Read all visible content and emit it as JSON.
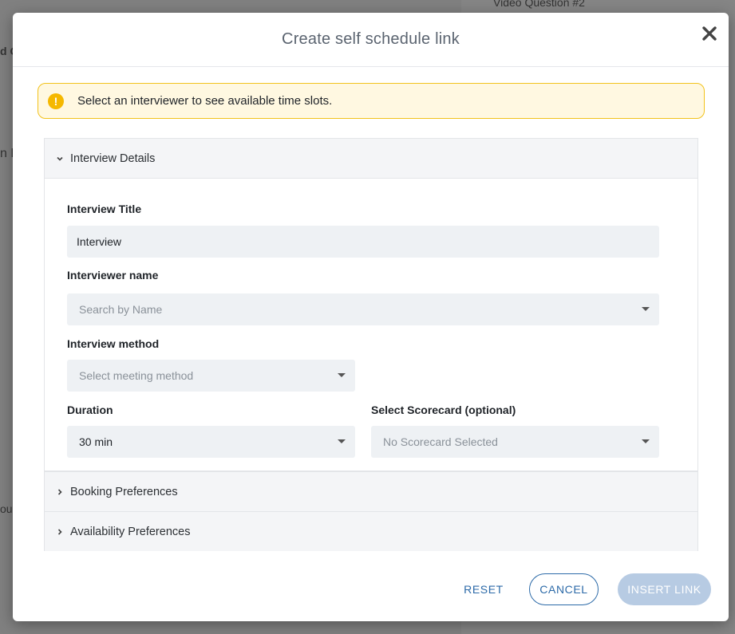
{
  "background": {
    "text_top": "Video Question #2",
    "text_left_1": "d G",
    "text_left_2": "n F",
    "text_left_3": "ou"
  },
  "modal": {
    "title": "Create self schedule link",
    "close_glyph": "✕"
  },
  "alert": {
    "icon_glyph": "!",
    "message": "Select an interviewer to see available time slots."
  },
  "sections": {
    "interview_details": {
      "label": "Interview Details",
      "expanded": true
    },
    "booking_preferences": {
      "label": "Booking Preferences",
      "expanded": false
    },
    "availability_preferences": {
      "label": "Availability Preferences",
      "expanded": false
    }
  },
  "form": {
    "interview_title": {
      "label": "Interview Title",
      "value": "Interview"
    },
    "interviewer_name": {
      "label": "Interviewer name",
      "placeholder": "Search by Name"
    },
    "interview_method": {
      "label": "Interview method",
      "placeholder": "Select meeting method"
    },
    "duration": {
      "label": "Duration",
      "value": "30 min"
    },
    "scorecard": {
      "label": "Select Scorecard (optional)",
      "placeholder": "No Scorecard Selected"
    }
  },
  "footer": {
    "reset_label": "RESET",
    "cancel_label": "CANCEL",
    "insert_label": "INSERT LINK"
  },
  "colors": {
    "accent": "#2c6aa8",
    "alert_border": "#f2c21b",
    "alert_bg": "#fff8e1",
    "alert_icon": "#f5b800",
    "disabled_button": "#b7cbe3",
    "input_bg": "#eef1f4"
  },
  "icons": {
    "close": "close-icon",
    "alert": "warning-icon",
    "expanded": "chevron-down-icon",
    "collapsed": "chevron-right-icon",
    "dropdown": "caret-down-icon"
  }
}
